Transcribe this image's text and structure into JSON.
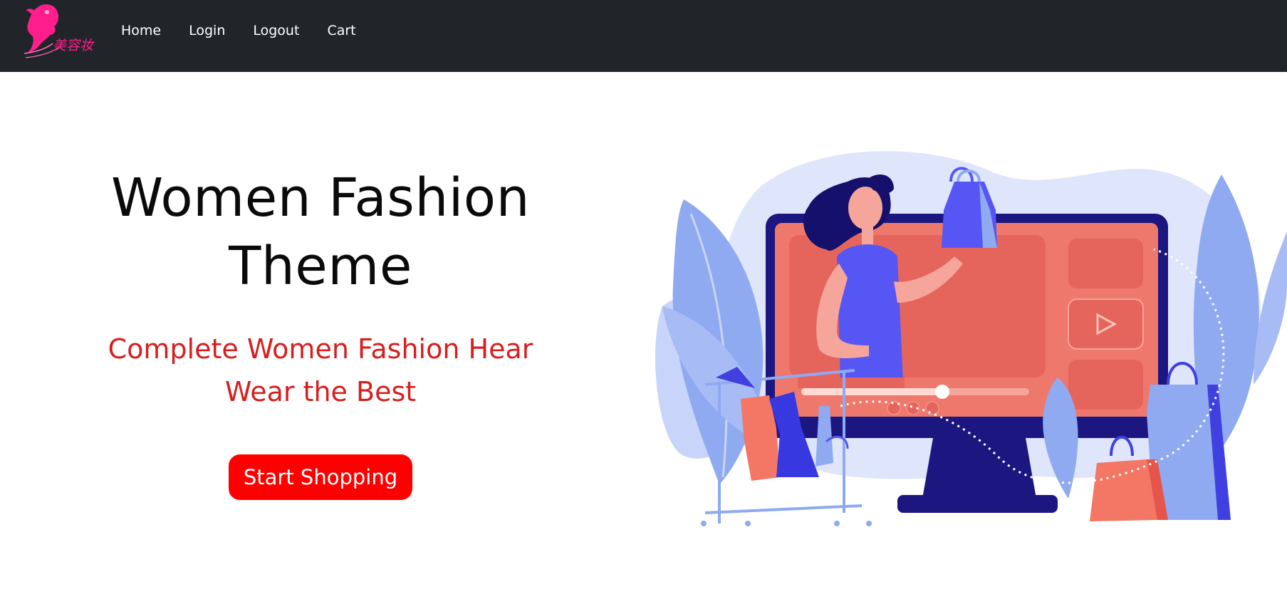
{
  "nav": {
    "logo": {
      "icon": "woman-silhouette-logo-icon",
      "text": "美容妆"
    },
    "links": [
      {
        "label": "Home"
      },
      {
        "label": "Login"
      },
      {
        "label": "Logout"
      },
      {
        "label": "Cart"
      }
    ]
  },
  "hero": {
    "title_line1": "Women Fashion",
    "title_line2": "Theme",
    "subtitle_line1": "Complete Women Fashion Hear",
    "subtitle_line2": "Wear the Best",
    "cta_label": "Start Shopping",
    "illustration": "online-fashion-shopping-illustration"
  },
  "colors": {
    "navbar_bg": "#212529",
    "subtitle": "#d81e1e",
    "cta_bg": "#ff0000",
    "logo_pink": "#ff1e8c"
  }
}
